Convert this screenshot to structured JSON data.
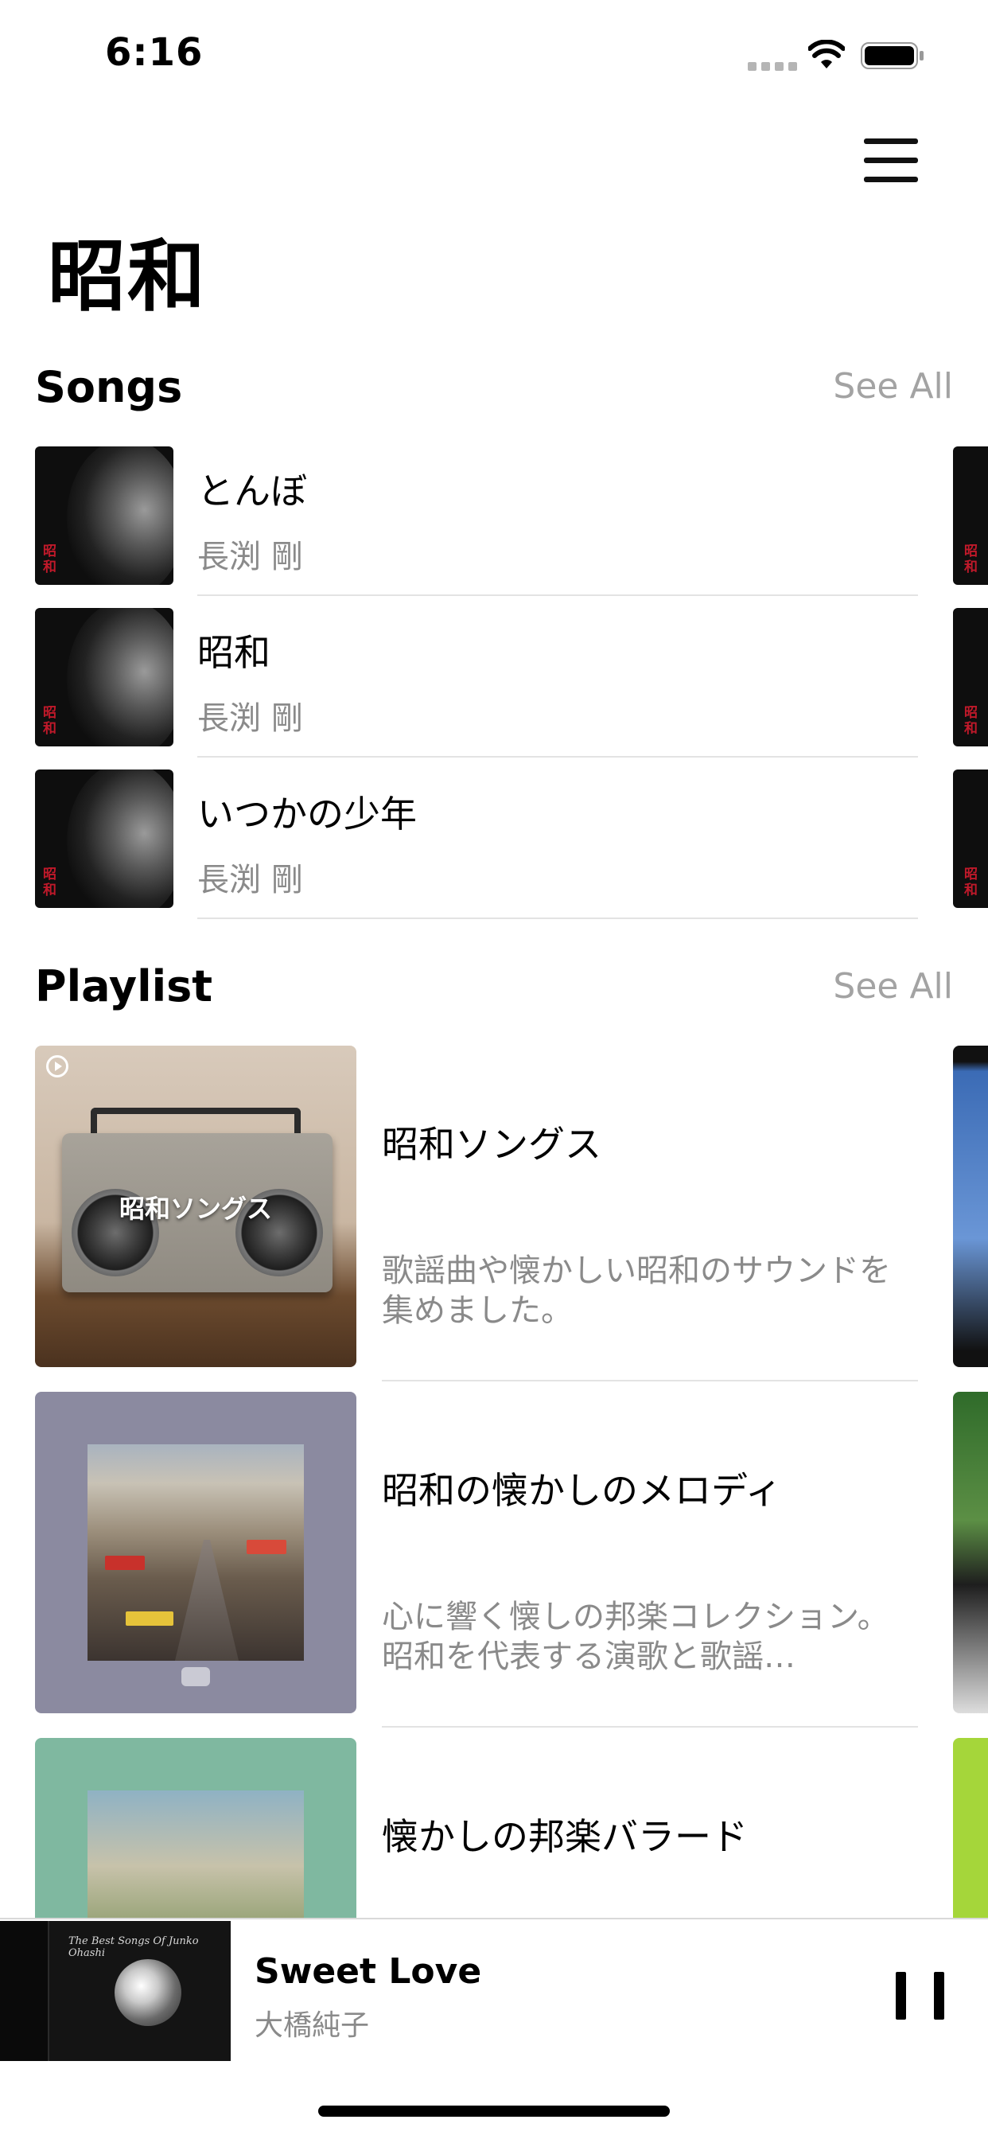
{
  "status_bar": {
    "time": "6:16"
  },
  "header": {
    "title": "昭和",
    "menu_icon": "hamburger-icon"
  },
  "songs_section": {
    "title": "Songs",
    "see_all": "See All",
    "items": [
      {
        "title": "とんぼ",
        "artist": "長渕 剛",
        "art_text": "昭和"
      },
      {
        "title": "昭和",
        "artist": "長渕 剛",
        "art_text": "昭和"
      },
      {
        "title": "いつかの少年",
        "artist": "長渕 剛",
        "art_text": "昭和"
      }
    ]
  },
  "playlist_section": {
    "title": "Playlist",
    "see_all": "See All",
    "items": [
      {
        "title": "昭和ソングス",
        "description": "歌謡曲や懐かしい昭和のサウンドを集めました。",
        "art_label": "昭和ソングス"
      },
      {
        "title": "昭和の懐かしのメロディ",
        "description": "心に響く懐しの邦楽コレクション。昭和を代表する演歌と歌謡…"
      },
      {
        "title": "懐かしの邦楽バラード"
      }
    ]
  },
  "now_playing": {
    "title": "Sweet Love",
    "artist": "大橋純子",
    "cover_text": "The Best Songs Of Junko Ohashi",
    "state": "playing"
  },
  "colors": {
    "accent_red": "#c0192a",
    "secondary_text": "#8a8a8a",
    "see_all": "#a3a3a3"
  }
}
